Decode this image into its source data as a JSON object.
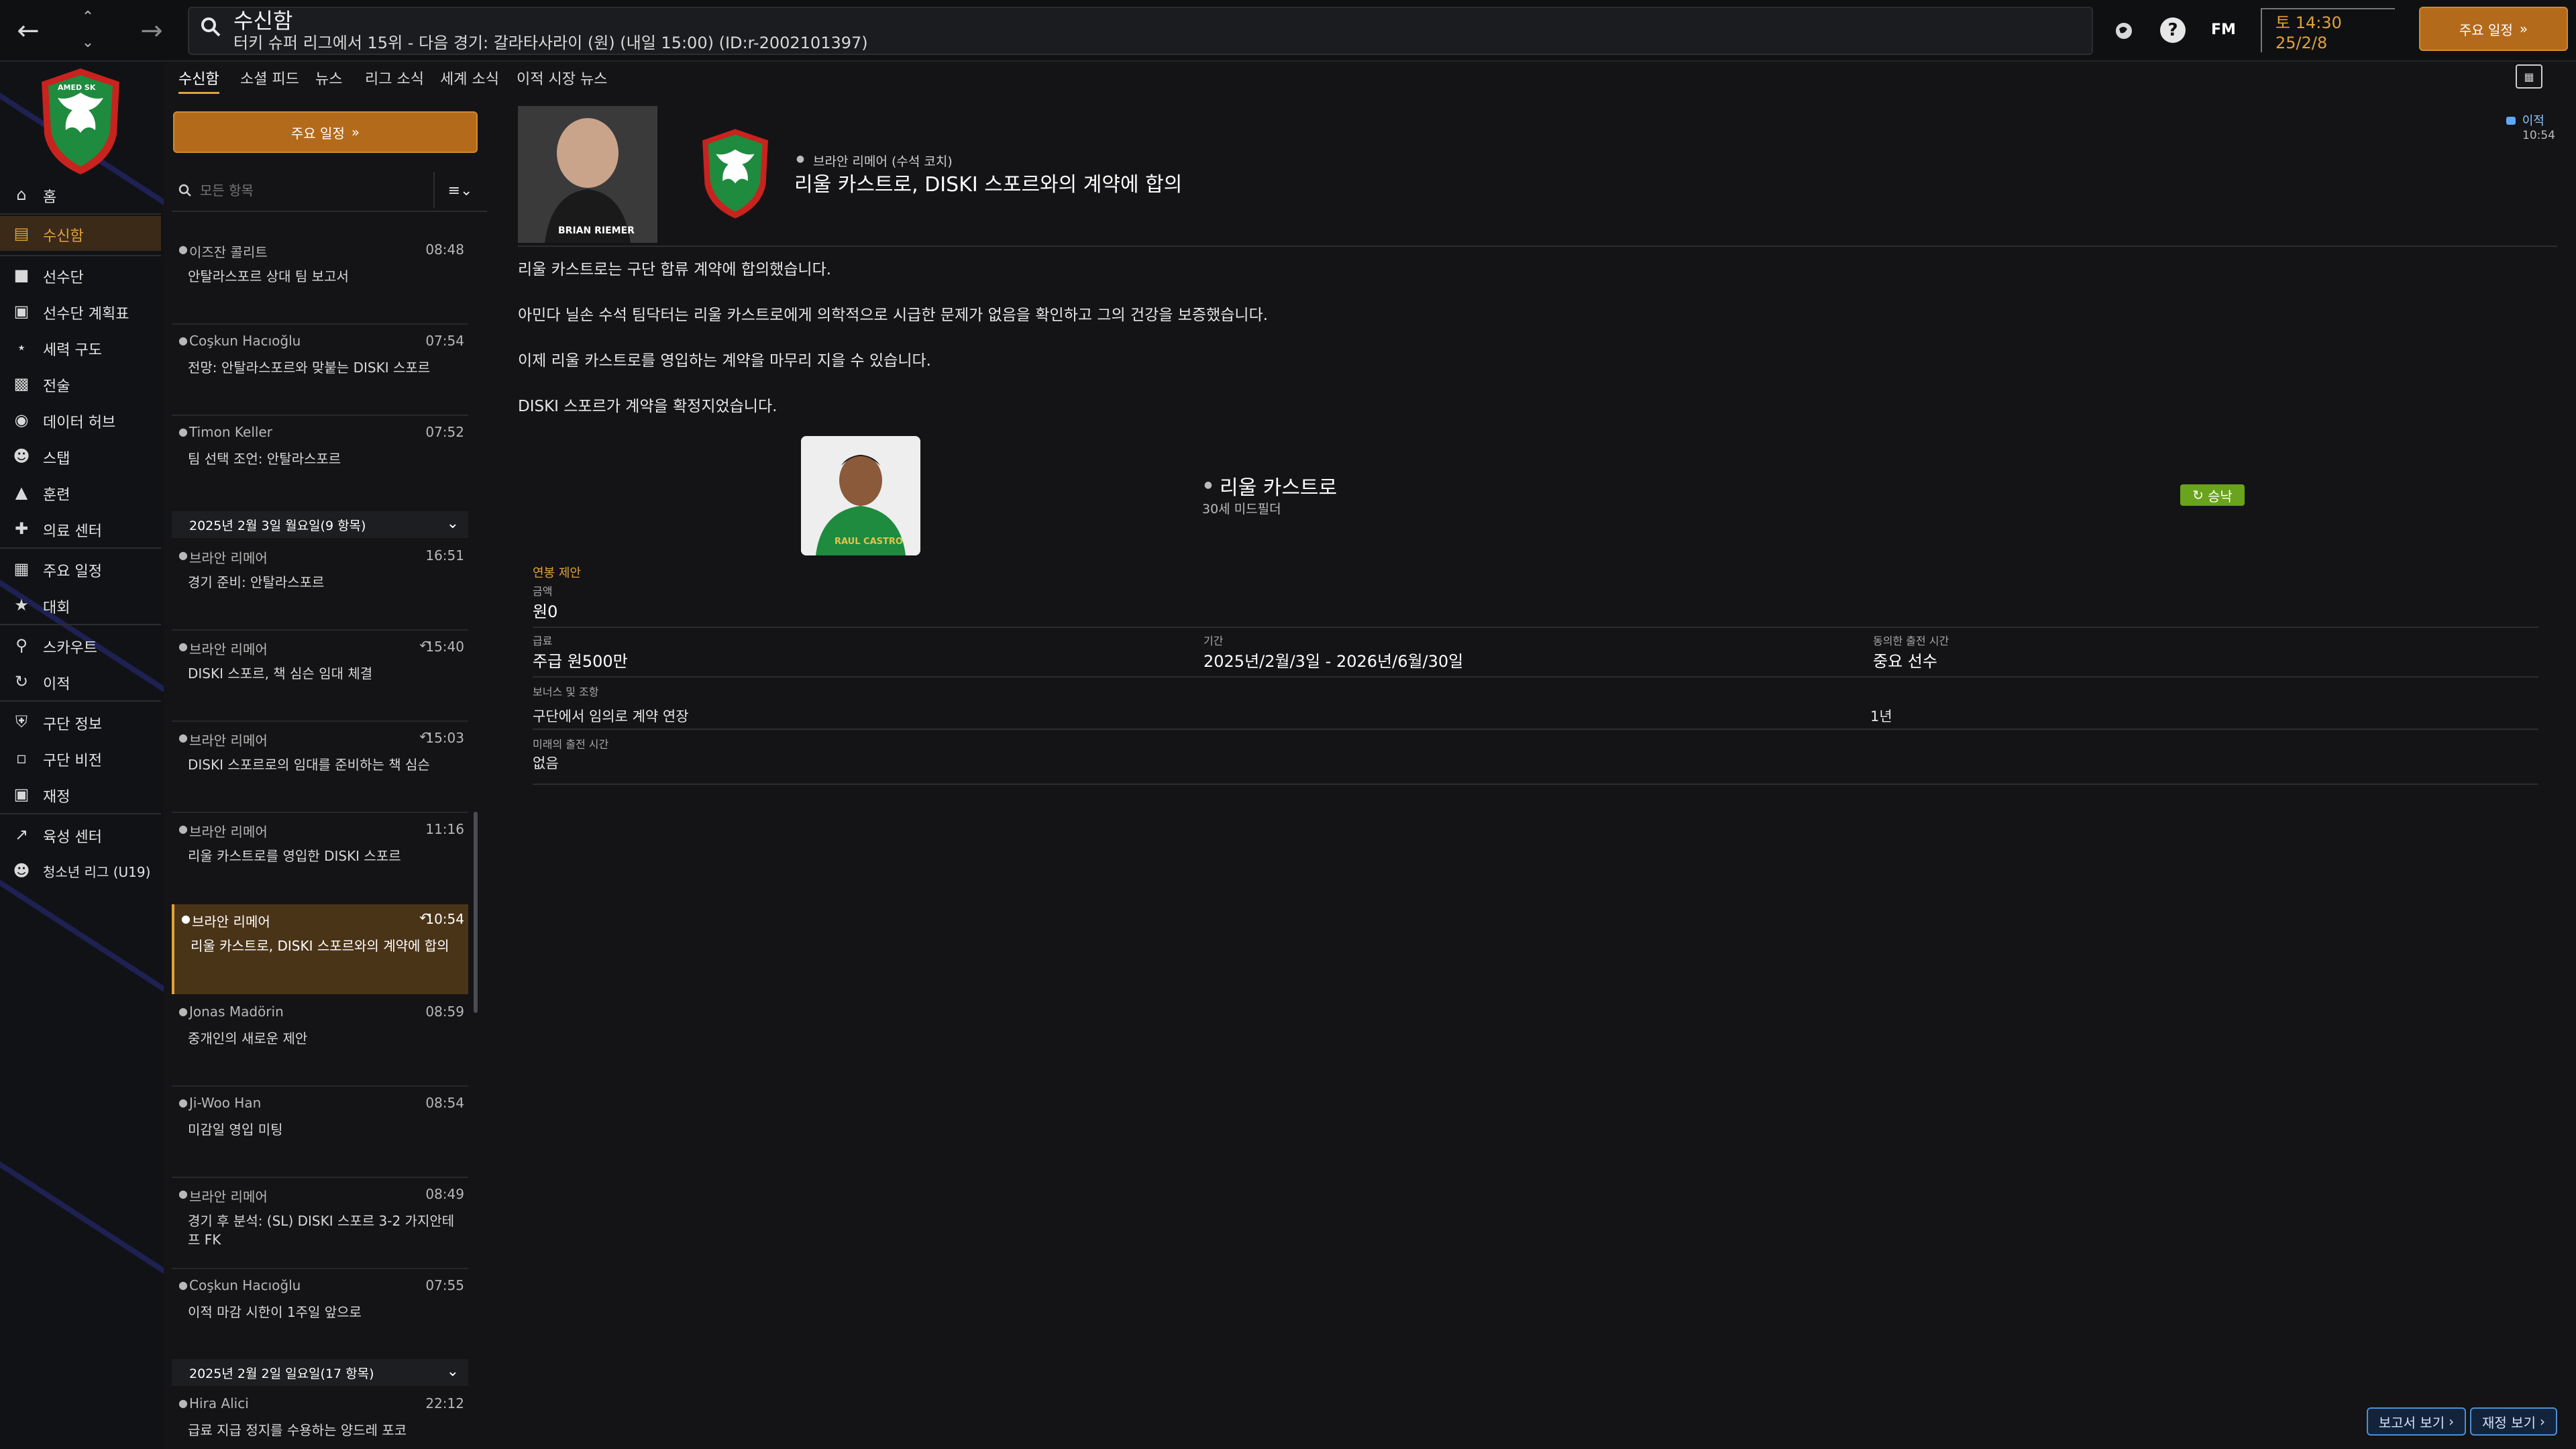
{
  "header": {
    "title": "수신함",
    "subtitle": "터키 슈퍼 리그에서 15위 - 다음 경기: 갈라타사라이 (원) (내일 15:00) (ID:r-2002101397)",
    "fm_label": "FM",
    "day": "토 14:30",
    "date": "25/2/8",
    "schedule_button": "주요 일정"
  },
  "club": {
    "logo_text": "AMED SK"
  },
  "sidebar": {
    "items": [
      {
        "label": "홈",
        "icon": "home-icon"
      },
      {
        "label": "수신함",
        "icon": "inbox-icon",
        "active": true
      },
      {
        "label": "선수단",
        "icon": "shirt-icon"
      },
      {
        "label": "선수단 계획표",
        "icon": "clipboard-icon"
      },
      {
        "label": "세력 구도",
        "icon": "network-icon"
      },
      {
        "label": "전술",
        "icon": "tactics-icon"
      },
      {
        "label": "데이터 허브",
        "icon": "data-icon"
      },
      {
        "label": "스탭",
        "icon": "staff-icon"
      },
      {
        "label": "훈련",
        "icon": "training-icon"
      },
      {
        "label": "의료 센터",
        "icon": "medical-icon"
      },
      {
        "label": "주요 일정",
        "icon": "calendar-icon"
      },
      {
        "label": "대회",
        "icon": "trophy-icon"
      },
      {
        "label": "스카우트",
        "icon": "scout-icon"
      },
      {
        "label": "이적",
        "icon": "transfer-icon"
      },
      {
        "label": "구단 정보",
        "icon": "shield-icon"
      },
      {
        "label": "구단 비전",
        "icon": "vision-icon"
      },
      {
        "label": "재정",
        "icon": "finance-icon"
      },
      {
        "label": "육성 센터",
        "icon": "development-icon"
      },
      {
        "label": "청소년 리그 (U19)",
        "icon": "youth-icon"
      }
    ]
  },
  "tabs": [
    "수신함",
    "소셜 피드",
    "뉴스",
    "리그 소식",
    "세계 소식",
    "이적 시장 뉴스"
  ],
  "list": {
    "schedule_button": "주요 일정",
    "search_placeholder": "모든 항목",
    "messages_top": [
      {
        "from": "이즈잔 콜리트",
        "time": "08:48",
        "subject": "안탈라스포르 상대 팀 보고서"
      },
      {
        "from": "Coşkun Hacıoğlu",
        "time": "07:54",
        "subject": "전망: 안탈라스포르와 맞붙는 DISKI 스포르"
      },
      {
        "from": "Timon Keller",
        "time": "07:52",
        "subject": "팀 선택 조언: 안탈라스포르"
      }
    ],
    "group1": "2025년 2월 3일 월요일(9 항목)",
    "messages_g1": [
      {
        "from": "브라안 리메어",
        "time": "16:51",
        "subject": "경기 준비: 안탈라스포르",
        "reply": false
      },
      {
        "from": "브라안 리메어",
        "time": "15:40",
        "subject": "DISKI 스포르, 책 심슨 임대 체결",
        "reply": true
      },
      {
        "from": "브라안 리메어",
        "time": "15:03",
        "subject": "DISKI 스포르로의 임대를 준비하는 책 심슨",
        "reply": true
      },
      {
        "from": "브라안 리메어",
        "time": "11:16",
        "subject": "리울 카스트로를 영입한 DISKI 스포르",
        "reply": false
      },
      {
        "from": "브라안 리메어",
        "time": "10:54",
        "subject": "리울 카스트로, DISKI 스포르와의 계약에 합의",
        "reply": true,
        "selected": true
      },
      {
        "from": "Jonas Madörin",
        "time": "08:59",
        "subject": "중개인의 새로운 제안",
        "reply": false
      },
      {
        "from": "Ji-Woo Han",
        "time": "08:54",
        "subject": "미감일 영입 미팅",
        "reply": false
      },
      {
        "from": "브라안 리메어",
        "time": "08:49",
        "subject": "경기 후 분석: (SL) DISKI 스포르 3-2 가지안테프 FK",
        "reply": false
      },
      {
        "from": "Coşkun Hacıoğlu",
        "time": "07:55",
        "subject": "이적 마감 시한이 1주일 앞으로",
        "reply": false
      }
    ],
    "group2": "2025년 2월 2일 일요일(17 항목)",
    "messages_g2": [
      {
        "from": "Hira Alici",
        "time": "22:12",
        "subject": "급료 지급 정지를 수용하는 양드레 포코"
      }
    ]
  },
  "message": {
    "sender": "브라안 리메어 (수석 코치)",
    "sender_photo_caption": "BRIAN RIEMER",
    "title": "리울 카스트로, DISKI 스포르와의 계약에 합의",
    "tag": "이적",
    "time": "10:54",
    "paragraphs": [
      "리울 카스트로는 구단 합류 계약에 합의했습니다.",
      "아민다 닐손 수석 팀닥터는 리울 카스트로에게 의학적으로 시급한 문제가 없음을 확인하고 그의 건강을 보증했습니다.",
      "이제 리울 카스트로를 영입하는 계약을 마무리 지을 수 있습니다.",
      "DISKI 스포르가 계약을 확정지었습니다."
    ],
    "player": {
      "name": "리울 카스트로",
      "desc": "30세 미드필더",
      "status": "승낙",
      "jersey_text": "RAUL CASTRO"
    },
    "contract": {
      "section_title": "연봉 제안",
      "fee_label": "금액",
      "fee": "원0",
      "wage_label": "급료",
      "wage": "주급 원500만",
      "period_label": "기간",
      "period": "2025년/2월/3일 - 2026년/6월/30일",
      "role_label": "동의한 출전 시간",
      "role": "중요 선수",
      "bonus_label": "보너스 및 조항",
      "bonus_name": "구단에서 임의로 계약 연장",
      "bonus_value": "1년",
      "future_label": "미래의 출전 시간",
      "future": "없음"
    },
    "buttons": {
      "report": "보고서 보기",
      "finance": "재정 보기"
    }
  },
  "colors": {
    "accent": "#e0a23a",
    "accept": "#6aa31c",
    "club_green": "#1e8b3e",
    "club_red": "#c8231e"
  }
}
